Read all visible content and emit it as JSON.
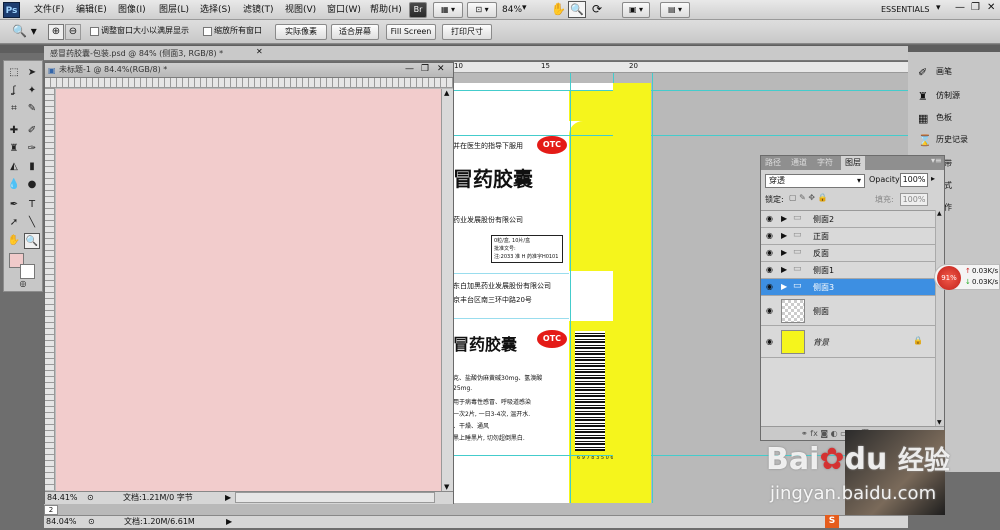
{
  "app": {
    "logo": "Ps",
    "menus": [
      "文件(F)",
      "编辑(E)",
      "图像(I)",
      "图层(L)",
      "选择(S)",
      "滤镜(T)",
      "视图(V)",
      "窗口(W)",
      "帮助(H)"
    ],
    "zoom_value": "84%",
    "workspace": "ESSENTIALS",
    "br_label": "Br",
    "mb_label": "Mb"
  },
  "options": {
    "resize_windows_label": "调整窗口大小以满屏显示",
    "zoom_all_label": "缩放所有窗口",
    "actual_pixels_label": "实际像素",
    "fit_screen_label": "适合屏幕",
    "fill_screen_label": "Fill Screen",
    "print_size_label": "打印尺寸"
  },
  "documents": {
    "back_tab_title": "感冒药胶囊-包装.psd @ 84% (侧面3, RGB/8) *",
    "untitled_title": "未标题-1 @ 84.4%(RGB/8) *",
    "untitled_zoom": "84.41%",
    "untitled_doc_info": "文档:1.21M/0 字节",
    "main_zoom": "84.04%",
    "main_doc_info": "文档:1.20M/6.61M",
    "row_indicator": "2",
    "untitled_bg": "#f2cccc"
  },
  "artwork": {
    "line1": "并在医生的指导下服用",
    "otc": "OTC",
    "product_title_1": "冒药胶囊",
    "company_1": "药业发展股份有限公司",
    "box_line1": "0粒/盒, 10片/盒",
    "box_line2": "批准文号:",
    "box_line3": "注:2033 准 H 药准字H0101",
    "company_2": "东白加黑药业发展股份有限公司",
    "address": "京丰台区南三环中路20号",
    "product_title_2": "冒药胶囊",
    "spec_1": "克、盐酸伪麻黄碱30mg、氢溴酸",
    "spec_2": "25mg.",
    "spec_3": "用于病毒性感冒、呼吸道感染",
    "spec_4": "一次2片, 一日3-4次, 温开水.",
    "spec_5": "、干燥、通风",
    "spec_6": "黑上睡黑片, 切勿超倒黑白.",
    "barcode_digits": "6 9 7 8 3 5 0 6 3 8 6 2",
    "ruler_marks": [
      "10",
      "15",
      "20"
    ],
    "yellow": "#f5f51c"
  },
  "layers_panel": {
    "tabs": [
      "路径",
      "通道",
      "字符",
      "图层"
    ],
    "blend_mode": "穿透",
    "opacity_label": "Opacity:",
    "opacity_value": "100%",
    "lock_label": "锁定:",
    "fill_label": "填充:",
    "fill_value": "100%",
    "layers": [
      {
        "name": "侧面2",
        "type": "group"
      },
      {
        "name": "正面",
        "type": "group"
      },
      {
        "name": "反面",
        "type": "group"
      },
      {
        "name": "侧面1",
        "type": "group"
      },
      {
        "name": "侧面3",
        "type": "group",
        "selected": true
      },
      {
        "name": "侧面",
        "type": "layer"
      },
      {
        "name": "背景",
        "type": "background"
      }
    ],
    "selected_color": "#3d8fe2"
  },
  "dock": {
    "items": [
      "画笔",
      "仿制源",
      "色板",
      "历史记录",
      "带",
      "式",
      "作"
    ]
  },
  "speed_widget": {
    "percent": "91%",
    "up": "0.03K/s",
    "down": "0.03K/s"
  },
  "watermark": {
    "brand": "Bai",
    "brand2": "du",
    "cn": "经验",
    "url": "jingyan.baidu.com"
  }
}
